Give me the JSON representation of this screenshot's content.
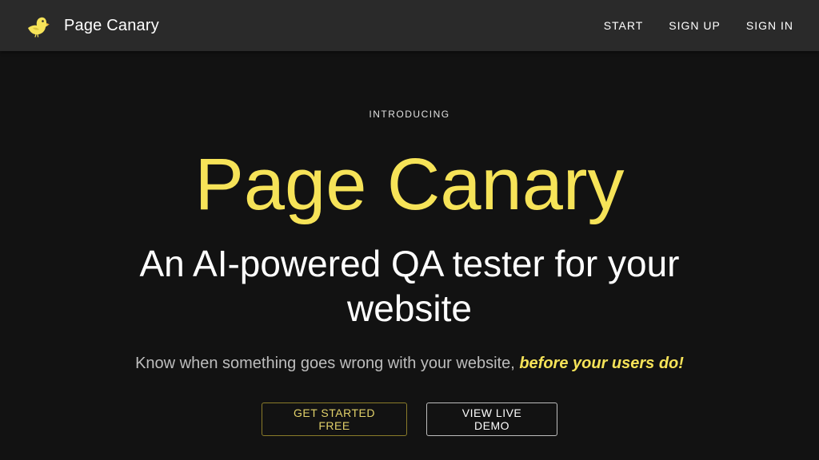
{
  "header": {
    "brand_name": "Page Canary",
    "logo_icon": "canary-bird-icon",
    "nav": [
      {
        "label": "START"
      },
      {
        "label": "SIGN UP"
      },
      {
        "label": "SIGN IN"
      }
    ]
  },
  "hero": {
    "kicker": "INTRODUCING",
    "title": "Page Canary",
    "subtitle": "An AI-powered QA tester for your website",
    "tagline_plain": "Know when something goes wrong with your website, ",
    "tagline_emphasis": "before your users do!",
    "primary_cta": "GET STARTED FREE",
    "secondary_cta": "VIEW LIVE DEMO"
  },
  "colors": {
    "accent": "#f6e358",
    "background": "#121212",
    "navbar": "#2a2a2a"
  }
}
